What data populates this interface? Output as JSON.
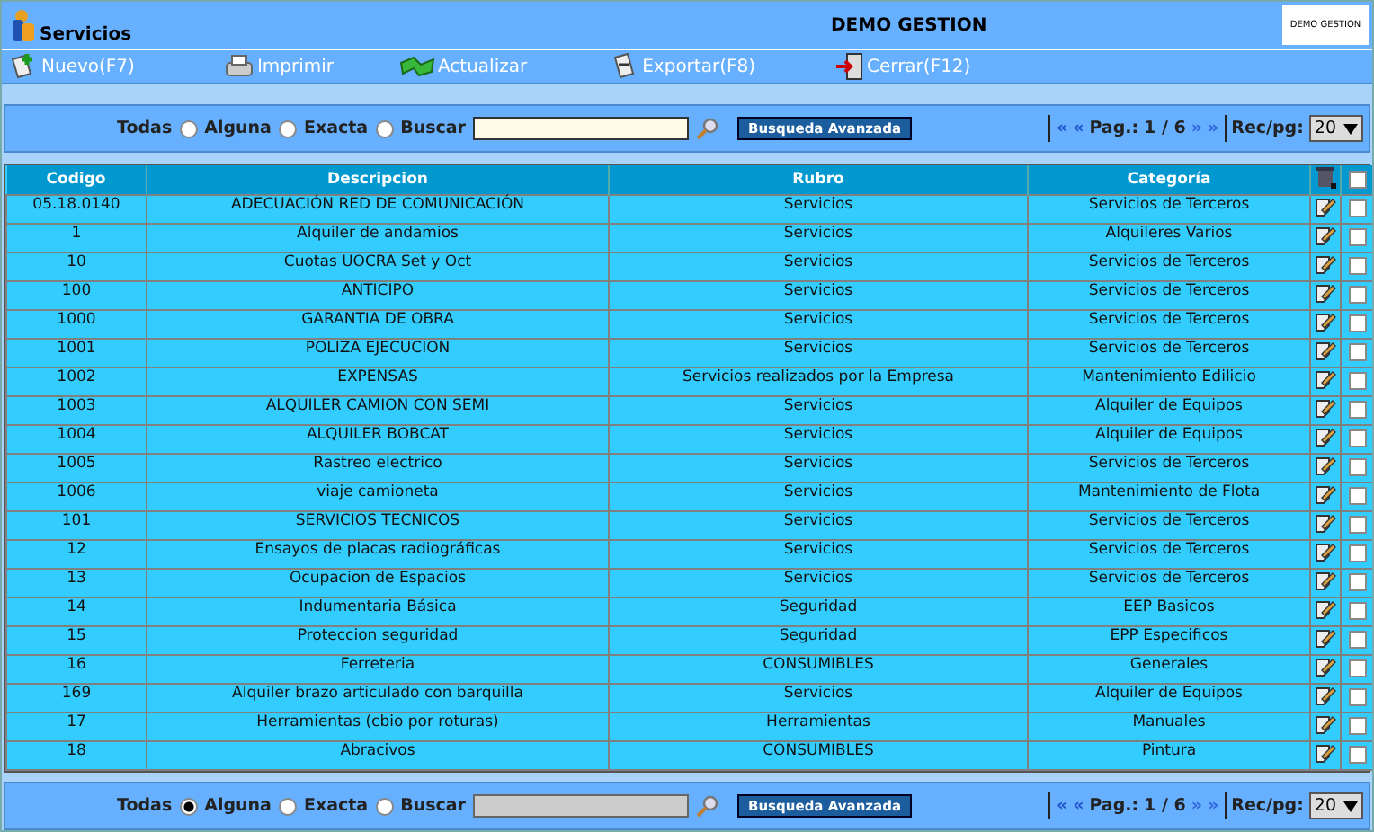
{
  "header": {
    "title": "Servicios",
    "company": "DEMO GESTION",
    "logo_text": "DEMO GESTION"
  },
  "toolbar": [
    {
      "kind": "new",
      "label": "Nuevo(F7)"
    },
    {
      "kind": "print",
      "label": "Imprimir"
    },
    {
      "kind": "refresh",
      "label": "Actualizar"
    },
    {
      "kind": "export",
      "label": "Exportar(F8)"
    },
    {
      "kind": "close",
      "label": "Cerrar(F12)"
    }
  ],
  "search_top": {
    "options": [
      {
        "label": "Todas",
        "selected": false
      },
      {
        "label": "Alguna",
        "selected": false
      },
      {
        "label": "Exacta",
        "selected": false
      }
    ],
    "search_label": "Buscar",
    "field_disabled": false,
    "advanced_button": "Busqueda Avanzada",
    "pager": {
      "first": "«",
      "prev": "«",
      "page_label": "Pag.:",
      "page": "1 / 6",
      "next": "»",
      "last": "»",
      "per_page_label": "Rec/pg:",
      "per_page": "20"
    }
  },
  "table": {
    "columns": [
      "Codigo",
      "Descripcion",
      "Rubro",
      "Categoría"
    ],
    "select_all_checked": false,
    "rows": [
      {
        "codigo": "05.18.0140",
        "descripcion": "ADECUACIÓN RED DE COMUNICACIÓN",
        "rubro": "Servicios",
        "categoria": "Servicios de Terceros",
        "checked": false
      },
      {
        "codigo": "1",
        "descripcion": "Alquiler de andamios",
        "rubro": "Servicios",
        "categoria": "Alquileres Varios",
        "checked": false
      },
      {
        "codigo": "10",
        "descripcion": "Cuotas UOCRA Set y Oct",
        "rubro": "Servicios",
        "categoria": "Servicios de Terceros",
        "checked": false
      },
      {
        "codigo": "100",
        "descripcion": "ANTICIPO",
        "rubro": "Servicios",
        "categoria": "Servicios de Terceros",
        "checked": false
      },
      {
        "codigo": "1000",
        "descripcion": "GARANTIA DE OBRA",
        "rubro": "Servicios",
        "categoria": "Servicios de Terceros",
        "checked": false
      },
      {
        "codigo": "1001",
        "descripcion": "POLIZA EJECUCION",
        "rubro": "Servicios",
        "categoria": "Servicios de Terceros",
        "checked": false
      },
      {
        "codigo": "1002",
        "descripcion": "EXPENSAS",
        "rubro": "Servicios realizados por la Empresa",
        "categoria": "Mantenimiento Edilicio",
        "checked": false
      },
      {
        "codigo": "1003",
        "descripcion": "ALQUILER CAMION CON SEMI",
        "rubro": "Servicios",
        "categoria": "Alquiler de Equipos",
        "checked": false
      },
      {
        "codigo": "1004",
        "descripcion": "ALQUILER BOBCAT",
        "rubro": "Servicios",
        "categoria": "Alquiler de Equipos",
        "checked": false
      },
      {
        "codigo": "1005",
        "descripcion": "Rastreo electrico",
        "rubro": "Servicios",
        "categoria": "Servicios de Terceros",
        "checked": false
      },
      {
        "codigo": "1006",
        "descripcion": "viaje camioneta",
        "rubro": "Servicios",
        "categoria": "Mantenimiento de Flota",
        "checked": false
      },
      {
        "codigo": "101",
        "descripcion": "SERVICIOS TECNICOS",
        "rubro": "Servicios",
        "categoria": "Servicios de Terceros",
        "checked": false
      },
      {
        "codigo": "12",
        "descripcion": "Ensayos de placas radiográficas",
        "rubro": "Servicios",
        "categoria": "Servicios de Terceros",
        "checked": false
      },
      {
        "codigo": "13",
        "descripcion": "Ocupacion de Espacios",
        "rubro": "Servicios",
        "categoria": "Servicios de Terceros",
        "checked": false
      },
      {
        "codigo": "14",
        "descripcion": "Indumentaria Básica",
        "rubro": "Seguridad",
        "categoria": "EEP Basicos",
        "checked": false
      },
      {
        "codigo": "15",
        "descripcion": "Proteccion seguridad",
        "rubro": "Seguridad",
        "categoria": "EPP Especificos",
        "checked": false
      },
      {
        "codigo": "16",
        "descripcion": "Ferreteria",
        "rubro": "CONSUMIBLES",
        "categoria": "Generales",
        "checked": false
      },
      {
        "codigo": "169",
        "descripcion": "Alquiler brazo articulado con barquilla",
        "rubro": "Servicios",
        "categoria": "Alquiler de Equipos",
        "checked": false
      },
      {
        "codigo": "17",
        "descripcion": "Herramientas (cbio por roturas)",
        "rubro": "Herramientas",
        "categoria": "Manuales",
        "checked": false
      },
      {
        "codigo": "18",
        "descripcion": "Abracivos",
        "rubro": "CONSUMIBLES",
        "categoria": "Pintura",
        "checked": false
      }
    ]
  },
  "search_bottom": {
    "options": [
      {
        "label": "Todas",
        "selected": true
      },
      {
        "label": "Alguna",
        "selected": false
      },
      {
        "label": "Exacta",
        "selected": false
      }
    ],
    "search_label": "Buscar",
    "field_disabled": true,
    "advanced_button": "Busqueda Avanzada",
    "pager": {
      "first": "«",
      "prev": "«",
      "page_label": "Pag.:",
      "page": "1 / 6",
      "next": "»",
      "last": "»",
      "per_page_label": "Rec/pg:",
      "per_page": "20"
    }
  }
}
